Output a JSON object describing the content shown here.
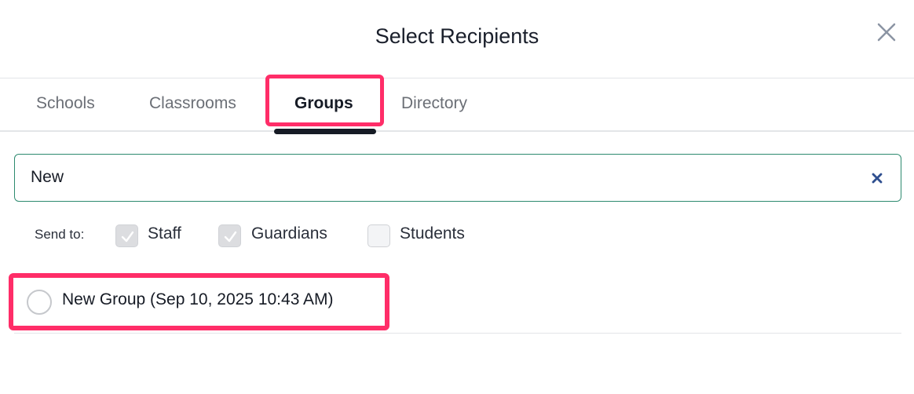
{
  "header": {
    "title": "Select Recipients",
    "close_icon": "close-icon"
  },
  "tabs": [
    {
      "label": "Schools",
      "active": false
    },
    {
      "label": "Classrooms",
      "active": false
    },
    {
      "label": "Groups",
      "active": true
    },
    {
      "label": "Directory",
      "active": false
    }
  ],
  "search": {
    "value": "New",
    "clear_icon": "clear-icon"
  },
  "send_to": {
    "label": "Send to:",
    "options": [
      {
        "label": "Staff",
        "checked": true
      },
      {
        "label": "Guardians",
        "checked": true
      },
      {
        "label": "Students",
        "checked": false
      }
    ]
  },
  "results": [
    {
      "label": "New Group (Sep 10, 2025 10:43 AM)",
      "selected": false
    }
  ],
  "colors": {
    "highlight": "#ff2d68",
    "search_border": "#2d8a6f",
    "clear_icon": "#2f4f8f",
    "active_tab": "#161b25"
  }
}
